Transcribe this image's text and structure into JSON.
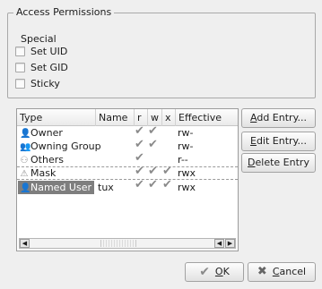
{
  "group": {
    "title": "Access Permissions",
    "special_label": "Special",
    "checks": [
      {
        "label": "Set UID",
        "checked": false
      },
      {
        "label": "Set GID",
        "checked": false
      },
      {
        "label": "Sticky",
        "checked": false
      }
    ]
  },
  "table": {
    "headers": [
      "Type",
      "Name",
      "r",
      "w",
      "x",
      "Effective"
    ],
    "rows": [
      {
        "type": "Owner",
        "icon": "user-icon",
        "name": "",
        "r": true,
        "w": true,
        "x": false,
        "effective": "rw-"
      },
      {
        "type": "Owning Group",
        "icon": "group-icon",
        "name": "",
        "r": true,
        "w": true,
        "x": false,
        "effective": "rw-"
      },
      {
        "type": "Others",
        "icon": "others-icon",
        "name": "",
        "r": true,
        "w": false,
        "x": false,
        "effective": "r--"
      },
      {
        "type": "Mask",
        "icon": "warning-icon",
        "name": "",
        "r": true,
        "w": true,
        "x": true,
        "effective": "rwx"
      },
      {
        "type": "Named User",
        "icon": "user-icon",
        "name": "tux",
        "r": true,
        "w": true,
        "x": true,
        "effective": "rwx",
        "selected": true
      }
    ]
  },
  "buttons": {
    "add_prefix": "A",
    "add_rest": "dd Entry...",
    "edit_prefix": "E",
    "edit_rest": "dit Entry...",
    "delete_prefix": "D",
    "delete_rest": "elete Entry",
    "ok_prefix": "O",
    "ok_rest": "K",
    "cancel_prefix": "C",
    "cancel_rest": "ancel"
  },
  "glyphs": {
    "check": "✔",
    "ok": "✔",
    "cancel": "✖",
    "arrow_left": "◀",
    "arrow_right": "▶"
  },
  "colors": {
    "selected_row": "#7e7e7e"
  }
}
